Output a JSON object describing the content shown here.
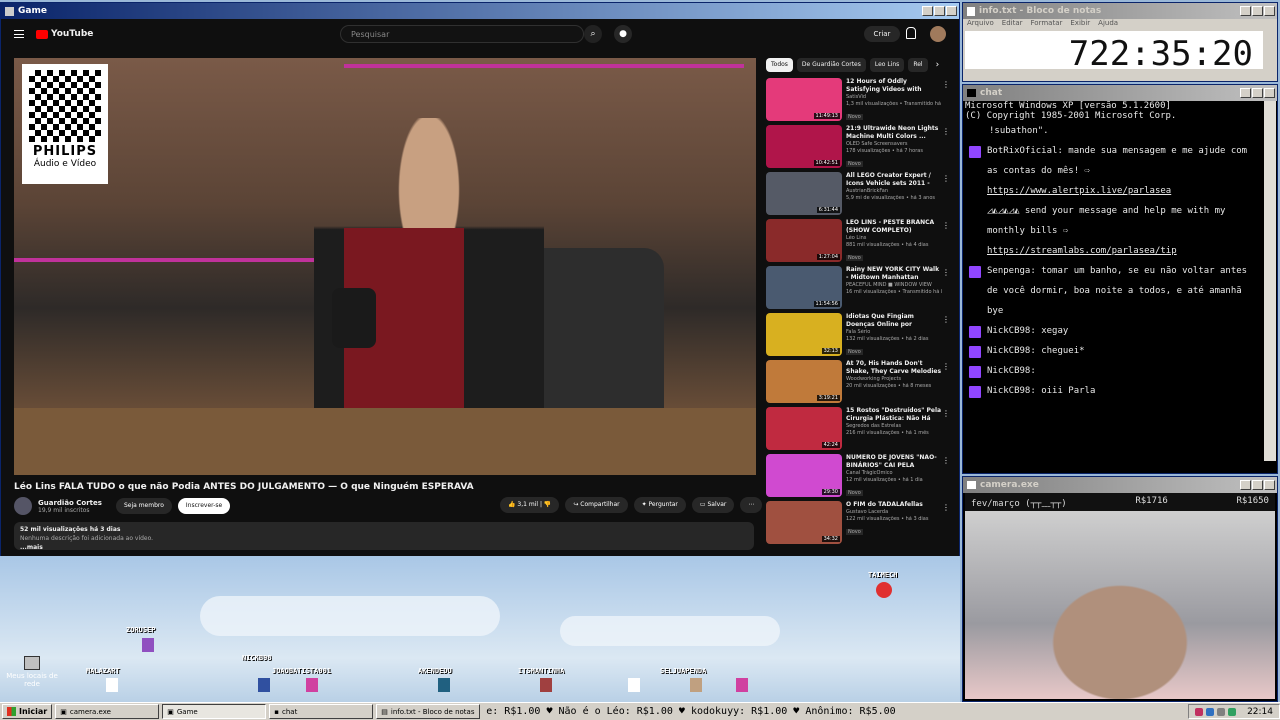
{
  "game_window": {
    "title": "Game"
  },
  "youtube": {
    "logo": "YouTube",
    "search_placeholder": "Pesquisar",
    "create": "Criar",
    "video_title": "Léo Lins FALA TUDO o que não Podia ANTES DO JULGAMENTO — O que Ninguém ESPERAVA",
    "channel_name": "Guardião Cortes",
    "channel_subs": "19,9 mil inscritos",
    "join": "Seja membro",
    "subscribe": "Inscrever-se",
    "likes": "3,1 mil",
    "share": "Compartilhar",
    "ask": "Perguntar",
    "save": "Salvar",
    "views_date": "52 mil visualizações  há 3 dias",
    "desc_text": "Nenhuma descrição foi adicionada ao vídeo.",
    "more": "...mais",
    "sponsor_brand": "PHILIPS",
    "sponsor_sub1": "Áudio e Vídeo",
    "chips": [
      "Todos",
      "De Guardião Cortes",
      "Leo Lins",
      "Rel"
    ],
    "recs": [
      {
        "title": "12 Hours of Oddly Satisfying Videos with Calming Music for...",
        "channel": "SatisVid",
        "meta": "1,3 mil visualizações • Transmitido há 1...",
        "badge": "Novo",
        "dur": "11:49:13",
        "color": "#e43a7a"
      },
      {
        "title": "21:9 Ultrawide Neon Lights Machine Multi Colors ...",
        "channel": "OLED Safe Screensavers",
        "meta": "178 visualizações • há 7 horas",
        "badge": "Novo",
        "dur": "10:42:51",
        "color": "#b0154a"
      },
      {
        "title": "All LEGO Creator Expert / Icons Vehicle sets 2011 - 2022 ...",
        "channel": "AustrianBrickFan",
        "meta": "5,9 mi de visualizações • há 3 anos",
        "badge": "",
        "dur": "6:31:44",
        "color": "#555a66"
      },
      {
        "title": "LÉO LINS - PESTE BRANCA (SHOW COMPLETO)",
        "channel": "Léo Lins",
        "meta": "881 mil visualizações • há 4 dias",
        "badge": "Novo",
        "dur": "1:27:04",
        "color": "#8a2a2a"
      },
      {
        "title": "Rainy NEW YORK CITY Walk - Midtown Manhattan Walking ...",
        "channel": "PEACEFUL MIND ■ WINDOW VIEW",
        "meta": "16 mil visualizações • Transmitido há 8...",
        "badge": "",
        "dur": "11:54:56",
        "color": "#4a5a70"
      },
      {
        "title": "Idiotas Que Fingiam Doenças Online por Dinheiro",
        "channel": "Fala Sério",
        "meta": "132 mil visualizações • há 2 dias",
        "badge": "Novo",
        "dur": "32:13",
        "color": "#d8b020"
      },
      {
        "title": "At 70, His Hands Don't Shake, They Carve Melodies into ...",
        "channel": "Woodworking Projects",
        "meta": "20 mil visualizações • há 8 meses",
        "badge": "",
        "dur": "3:19:21",
        "color": "#c07a3a"
      },
      {
        "title": "15 Rostos \"Destruídos\" Pela Cirurgia Plástica: Não Há Volta!",
        "channel": "Segredos das Estrelas",
        "meta": "216 mil visualizações • há 1 mês",
        "badge": "",
        "dur": "42:24",
        "color": "#c02a40"
      },
      {
        "title": "NÚMERO DE JOVENS \"NÃO-BINÁRIOS\" CAI PELA METADE...",
        "channel": "Canal TrágicÔmico",
        "meta": "12 mil visualizações • há 1 dia",
        "badge": "Novo",
        "dur": "29:30",
        "color": "#d04ad0"
      },
      {
        "title": "O FIM do TADALAfellas",
        "channel": "Gustavo Lacerda",
        "meta": "122 mil visualizações • há 3 dias",
        "badge": "Novo",
        "dur": "34:32",
        "color": "#a05040"
      }
    ]
  },
  "notepad": {
    "title": "info.txt - Bloco de notas",
    "menu": [
      "Arquivo",
      "Editar",
      "Formatar",
      "Exibir",
      "Ajuda"
    ],
    "timer": "722:35:20"
  },
  "chat": {
    "title": "chat",
    "sys1": "Microsoft Windows XP [versão 5.1.2600]",
    "sys2": "(C) Copyright 1985-2001 Microsoft Corp.",
    "cmd": "!subathon\".",
    "messages": [
      {
        "user": "BotRixOficial:",
        "text": " mande sua mensagem e me ajude com as contas do mês! ⇨"
      },
      {
        "user": "",
        "text": "https://www.alertpix.live/parlasea"
      },
      {
        "user": "",
        "text": "◿◭◿◭◿◭ send your message and help me with my monthly bills ⇨"
      },
      {
        "user": "",
        "text": "https://streamlabs.com/parlasea/tip"
      },
      {
        "user": "Senpenga:",
        "text": " tomar um banho, se eu não voltar antes de você dormir, boa noite a todos, e até amanhã bye"
      },
      {
        "user": "NickCB98:",
        "text": " xegay"
      },
      {
        "user": "NickCB98:",
        "text": " cheguei*"
      },
      {
        "user": "NickCB98:",
        "text": " "
      },
      {
        "user": "NickCB98:",
        "text": " oiii Parla"
      }
    ]
  },
  "camera": {
    "title": "camera.exe",
    "label": "fev/março (┬┬﹏┬┬)",
    "amount1": "R$1716",
    "amount2": "R$1650"
  },
  "game": {
    "names": [
      "TAIMECH",
      "ZORUSEP",
      "NICKB98",
      "MALAZART",
      "JOAOBATISTA001",
      "AKENDEDU",
      "ITSMANTINHA",
      "SELJUAPENDA"
    ]
  },
  "desktop_icon": "Meus locais de rede",
  "taskbar": {
    "start": "Iniciar",
    "tasks": [
      "camera.exe",
      "Game",
      "chat",
      "info.txt - Bloco de notas"
    ],
    "ticker": "e: R$1.00  ♥ Não é o Léo: R$1.00  ♥ kodokuyy: R$1.00  ♥ Anônimo: R$5.00",
    "clock": "22:14"
  },
  "colors": {
    "yt_bg": "#0f0f0f",
    "twitch": "#9146ff",
    "xp_title": "#0a246a"
  }
}
